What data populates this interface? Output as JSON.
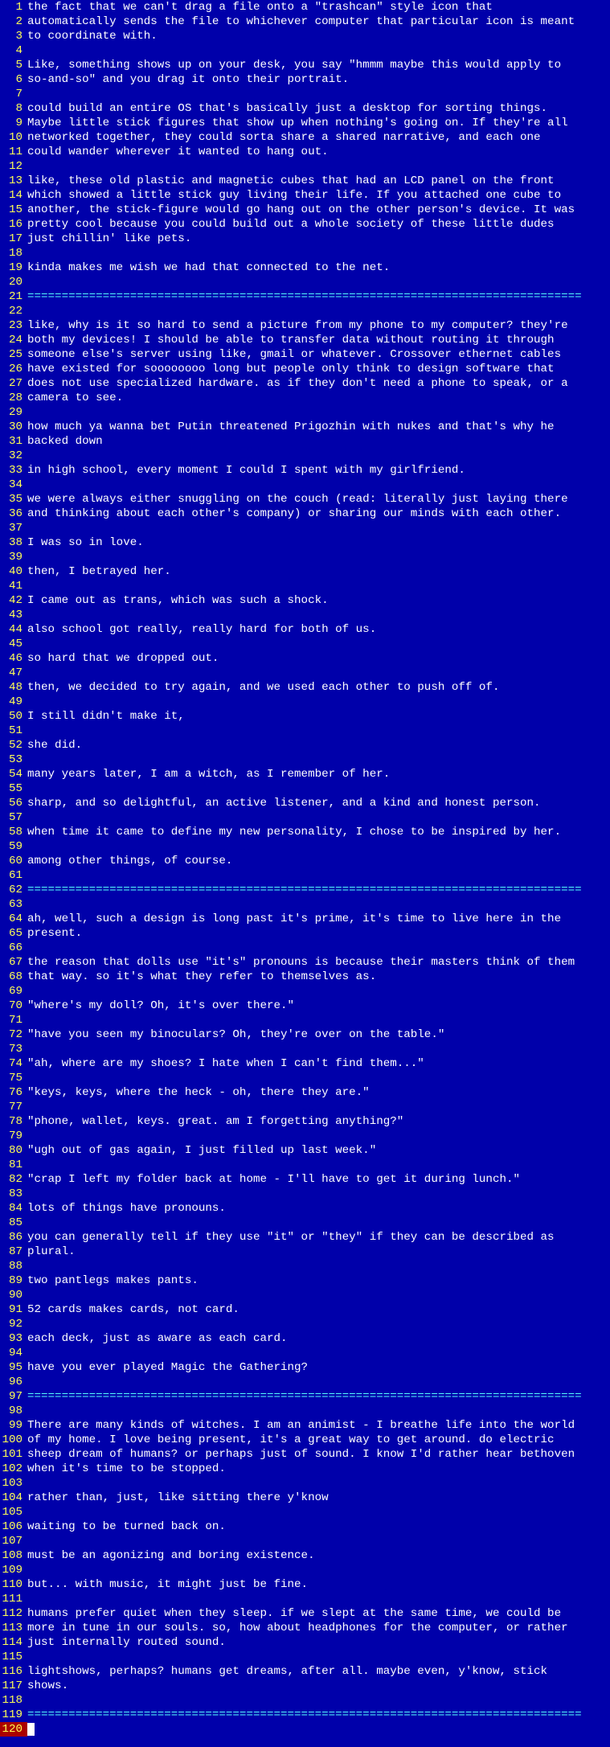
{
  "editor": {
    "type": "text-editor",
    "cursor_line": 120,
    "lines": [
      {
        "n": 1,
        "t": "the fact that we can't drag a file onto a \"trashcan\" style icon that"
      },
      {
        "n": 2,
        "t": "automatically sends the file to whichever computer that particular icon is meant"
      },
      {
        "n": 3,
        "t": "to coordinate with."
      },
      {
        "n": 4,
        "t": ""
      },
      {
        "n": 5,
        "t": "Like, something shows up on your desk, you say \"hmmm maybe this would apply to"
      },
      {
        "n": 6,
        "t": "so-and-so\" and you drag it onto their portrait."
      },
      {
        "n": 7,
        "t": ""
      },
      {
        "n": 8,
        "t": "could build an entire OS that's basically just a desktop for sorting things."
      },
      {
        "n": 9,
        "t": "Maybe little stick figures that show up when nothing's going on. If they're all"
      },
      {
        "n": 10,
        "t": "networked together, they could sorta share a shared narrative, and each one"
      },
      {
        "n": 11,
        "t": "could wander wherever it wanted to hang out."
      },
      {
        "n": 12,
        "t": ""
      },
      {
        "n": 13,
        "t": "like, these old plastic and magnetic cubes that had an LCD panel on the front"
      },
      {
        "n": 14,
        "t": "which showed a little stick guy living their life. If you attached one cube to"
      },
      {
        "n": 15,
        "t": "another, the stick-figure would go hang out on the other person's device. It was"
      },
      {
        "n": 16,
        "t": "pretty cool because you could build out a whole society of these little dudes"
      },
      {
        "n": 17,
        "t": "just chillin' like pets."
      },
      {
        "n": 18,
        "t": ""
      },
      {
        "n": 19,
        "t": "kinda makes me wish we had that connected to the net."
      },
      {
        "n": 20,
        "t": ""
      },
      {
        "n": 21,
        "t": "=================================================================================",
        "rule": true
      },
      {
        "n": 22,
        "t": ""
      },
      {
        "n": 23,
        "t": "like, why is it so hard to send a picture from my phone to my computer? they're"
      },
      {
        "n": 24,
        "t": "both my devices! I should be able to transfer data without routing it through"
      },
      {
        "n": 25,
        "t": "someone else's server using like, gmail or whatever. Crossover ethernet cables"
      },
      {
        "n": 26,
        "t": "have existed for soooooooo long but people only think to design software that"
      },
      {
        "n": 27,
        "t": "does not use specialized hardware. as if they don't need a phone to speak, or a"
      },
      {
        "n": 28,
        "t": "camera to see."
      },
      {
        "n": 29,
        "t": ""
      },
      {
        "n": 30,
        "t": "how much ya wanna bet Putin threatened Prigozhin with nukes and that's why he"
      },
      {
        "n": 31,
        "t": "backed down"
      },
      {
        "n": 32,
        "t": ""
      },
      {
        "n": 33,
        "t": "in high school, every moment I could I spent with my girlfriend."
      },
      {
        "n": 34,
        "t": ""
      },
      {
        "n": 35,
        "t": "we were always either snuggling on the couch (read: literally just laying there"
      },
      {
        "n": 36,
        "t": "and thinking about each other's company) or sharing our minds with each other."
      },
      {
        "n": 37,
        "t": ""
      },
      {
        "n": 38,
        "t": "I was so in love."
      },
      {
        "n": 39,
        "t": ""
      },
      {
        "n": 40,
        "t": "then, I betrayed her."
      },
      {
        "n": 41,
        "t": ""
      },
      {
        "n": 42,
        "t": "I came out as trans, which was such a shock."
      },
      {
        "n": 43,
        "t": ""
      },
      {
        "n": 44,
        "t": "also school got really, really hard for both of us."
      },
      {
        "n": 45,
        "t": ""
      },
      {
        "n": 46,
        "t": "so hard that we dropped out."
      },
      {
        "n": 47,
        "t": ""
      },
      {
        "n": 48,
        "t": "then, we decided to try again, and we used each other to push off of."
      },
      {
        "n": 49,
        "t": ""
      },
      {
        "n": 50,
        "t": "I still didn't make it,"
      },
      {
        "n": 51,
        "t": ""
      },
      {
        "n": 52,
        "t": "she did."
      },
      {
        "n": 53,
        "t": ""
      },
      {
        "n": 54,
        "t": "many years later, I am a witch, as I remember of her."
      },
      {
        "n": 55,
        "t": ""
      },
      {
        "n": 56,
        "t": "sharp, and so delightful, an active listener, and a kind and honest person."
      },
      {
        "n": 57,
        "t": ""
      },
      {
        "n": 58,
        "t": "when time it came to define my new personality, I chose to be inspired by her."
      },
      {
        "n": 59,
        "t": ""
      },
      {
        "n": 60,
        "t": "among other things, of course."
      },
      {
        "n": 61,
        "t": ""
      },
      {
        "n": 62,
        "t": "=================================================================================",
        "rule": true
      },
      {
        "n": 63,
        "t": ""
      },
      {
        "n": 64,
        "t": "ah, well, such a design is long past it's prime, it's time to live here in the"
      },
      {
        "n": 65,
        "t": "present."
      },
      {
        "n": 66,
        "t": ""
      },
      {
        "n": 67,
        "t": "the reason that dolls use \"it's\" pronouns is because their masters think of them"
      },
      {
        "n": 68,
        "t": "that way. so it's what they refer to themselves as."
      },
      {
        "n": 69,
        "t": ""
      },
      {
        "n": 70,
        "t": "\"where's my doll? Oh, it's over there.\""
      },
      {
        "n": 71,
        "t": ""
      },
      {
        "n": 72,
        "t": "\"have you seen my binoculars? Oh, they're over on the table.\""
      },
      {
        "n": 73,
        "t": ""
      },
      {
        "n": 74,
        "t": "\"ah, where are my shoes? I hate when I can't find them...\""
      },
      {
        "n": 75,
        "t": ""
      },
      {
        "n": 76,
        "t": "\"keys, keys, where the heck - oh, there they are.\""
      },
      {
        "n": 77,
        "t": ""
      },
      {
        "n": 78,
        "t": "\"phone, wallet, keys. great. am I forgetting anything?\""
      },
      {
        "n": 79,
        "t": ""
      },
      {
        "n": 80,
        "t": "\"ugh out of gas again, I just filled up last week.\""
      },
      {
        "n": 81,
        "t": ""
      },
      {
        "n": 82,
        "t": "\"crap I left my folder back at home - I'll have to get it during lunch.\""
      },
      {
        "n": 83,
        "t": ""
      },
      {
        "n": 84,
        "t": "lots of things have pronouns."
      },
      {
        "n": 85,
        "t": ""
      },
      {
        "n": 86,
        "t": "you can generally tell if they use \"it\" or \"they\" if they can be described as"
      },
      {
        "n": 87,
        "t": "plural."
      },
      {
        "n": 88,
        "t": ""
      },
      {
        "n": 89,
        "t": "two pantlegs makes pants."
      },
      {
        "n": 90,
        "t": ""
      },
      {
        "n": 91,
        "t": "52 cards makes cards, not card."
      },
      {
        "n": 92,
        "t": ""
      },
      {
        "n": 93,
        "t": "each deck, just as aware as each card."
      },
      {
        "n": 94,
        "t": ""
      },
      {
        "n": 95,
        "t": "have you ever played Magic the Gathering?"
      },
      {
        "n": 96,
        "t": ""
      },
      {
        "n": 97,
        "t": "=================================================================================",
        "rule": true
      },
      {
        "n": 98,
        "t": ""
      },
      {
        "n": 99,
        "t": "There are many kinds of witches. I am an animist - I breathe life into the world"
      },
      {
        "n": 100,
        "t": "of my home. I love being present, it's a great way to get around. do electric"
      },
      {
        "n": 101,
        "t": "sheep dream of humans? or perhaps just of sound. I know I'd rather hear bethoven"
      },
      {
        "n": 102,
        "t": "when it's time to be stopped."
      },
      {
        "n": 103,
        "t": ""
      },
      {
        "n": 104,
        "t": "rather than, just, like sitting there y'know"
      },
      {
        "n": 105,
        "t": ""
      },
      {
        "n": 106,
        "t": "waiting to be turned back on."
      },
      {
        "n": 107,
        "t": ""
      },
      {
        "n": 108,
        "t": "must be an agonizing and boring existence."
      },
      {
        "n": 109,
        "t": ""
      },
      {
        "n": 110,
        "t": "but... with music, it might just be fine."
      },
      {
        "n": 111,
        "t": ""
      },
      {
        "n": 112,
        "t": "humans prefer quiet when they sleep. if we slept at the same time, we could be"
      },
      {
        "n": 113,
        "t": "more in tune in our souls. so, how about headphones for the computer, or rather"
      },
      {
        "n": 114,
        "t": "just internally routed sound."
      },
      {
        "n": 115,
        "t": ""
      },
      {
        "n": 116,
        "t": "lightshows, perhaps? humans get dreams, after all. maybe even, y'know, stick"
      },
      {
        "n": 117,
        "t": "shows."
      },
      {
        "n": 118,
        "t": ""
      },
      {
        "n": 119,
        "t": "=================================================================================",
        "rule": true
      },
      {
        "n": 120,
        "t": "",
        "cursor": true
      }
    ]
  }
}
